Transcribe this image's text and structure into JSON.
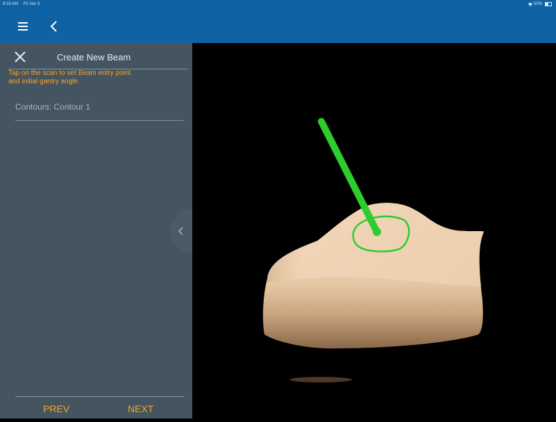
{
  "status_bar": {
    "time": "9:23 AM",
    "date": "Fri Jan 3",
    "battery": "53%"
  },
  "nav": {
    "menu_icon": "hamburger-menu-icon",
    "back_icon": "chevron-left-icon"
  },
  "panel": {
    "title": "Create New Beam",
    "close_icon": "close-icon",
    "hint_line1": "Tap on the scan to set Beam entry point",
    "hint_line2": "and initial gantry angle.",
    "contours_label": "Contours: Contour 1",
    "collapse_icon": "chevron-left-icon",
    "prev_label": "PREV",
    "next_label": "NEXT"
  },
  "colors": {
    "header_blue": "#0f63a5",
    "panel_bg": "#455461",
    "accent_orange": "#f5a623",
    "beam_green": "#2ecc2e"
  }
}
